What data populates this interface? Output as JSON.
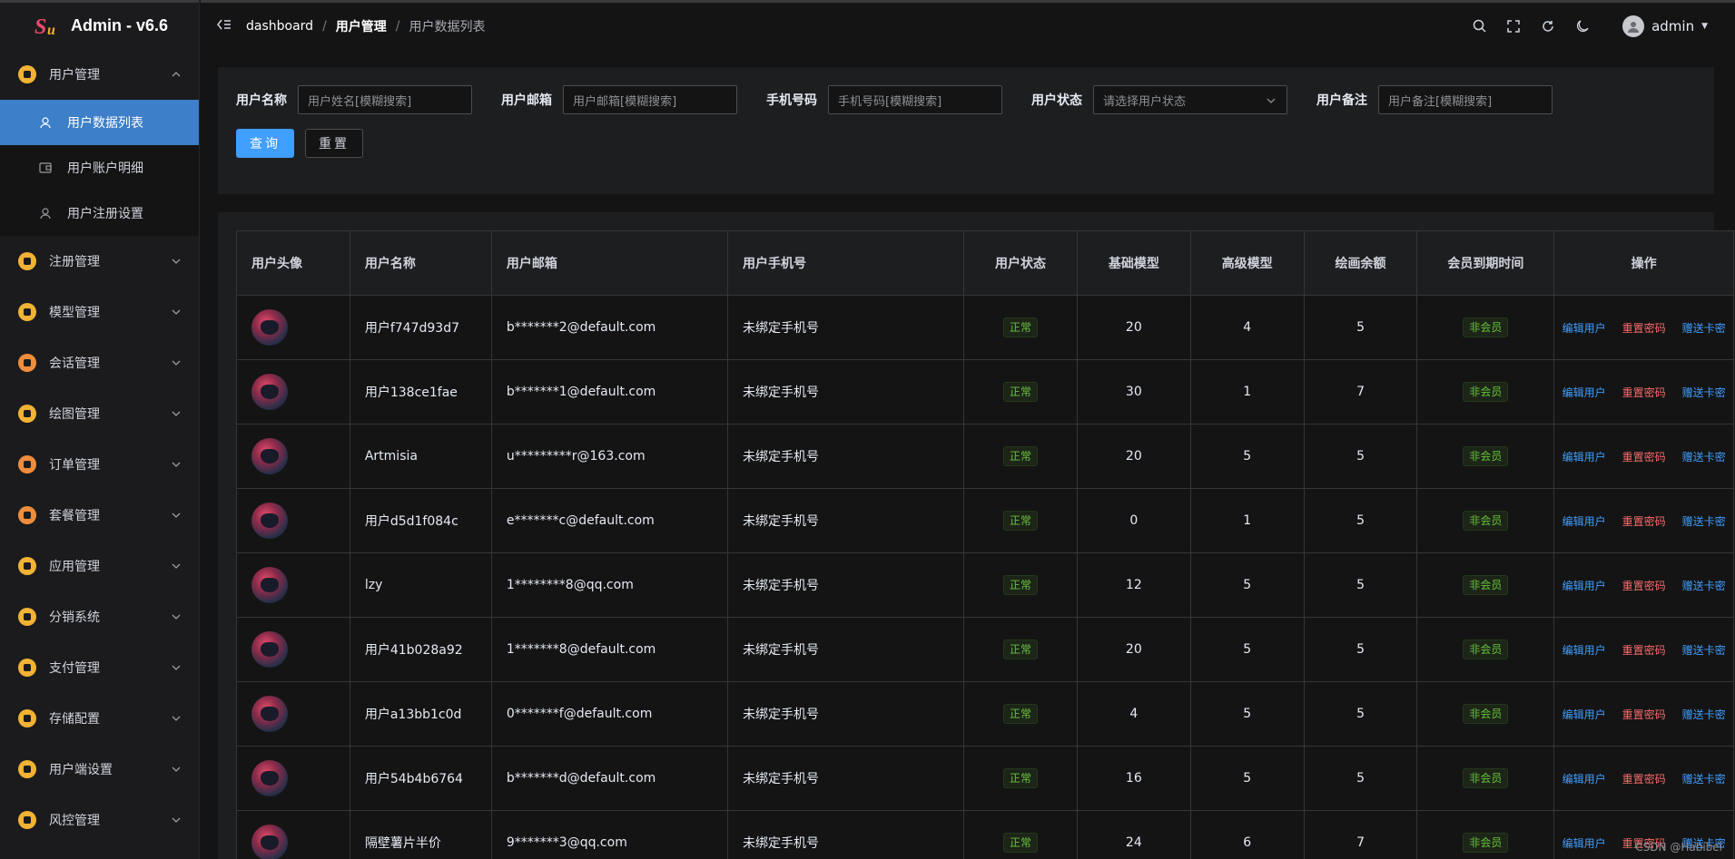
{
  "app": {
    "title": "Admin - v6.6"
  },
  "sidebar": {
    "groups": [
      {
        "label": "用户管理",
        "icon": "user-card-icon",
        "color": "#f2b233",
        "expanded": true,
        "children": [
          {
            "label": "用户数据列表",
            "icon": "user-outline-icon",
            "active": true
          },
          {
            "label": "用户账户明细",
            "icon": "wallet-icon",
            "active": false
          },
          {
            "label": "用户注册设置",
            "icon": "user-outline-icon",
            "active": false
          }
        ]
      },
      {
        "label": "注册管理",
        "icon": "register-icon",
        "color": "#f2b233"
      },
      {
        "label": "模型管理",
        "icon": "model-icon",
        "color": "#f2b233"
      },
      {
        "label": "会话管理",
        "icon": "chat-icon",
        "color": "#f08d3c"
      },
      {
        "label": "绘图管理",
        "icon": "palette-icon",
        "color": "#f2b233"
      },
      {
        "label": "订单管理",
        "icon": "clipboard-icon",
        "color": "#f08d3c"
      },
      {
        "label": "套餐管理",
        "icon": "package-icon",
        "color": "#f08d3c"
      },
      {
        "label": "应用管理",
        "icon": "apps-icon",
        "color": "#f2b233"
      },
      {
        "label": "分销系统",
        "icon": "distribution-icon",
        "color": "#f2b233"
      },
      {
        "label": "支付管理",
        "icon": "payment-icon",
        "color": "#f2b233"
      },
      {
        "label": "存储配置",
        "icon": "storage-icon",
        "color": "#f2b233"
      },
      {
        "label": "用户端设置",
        "icon": "client-settings-icon",
        "color": "#f2b233"
      },
      {
        "label": "风控管理",
        "icon": "shield-icon",
        "color": "#f2b233"
      }
    ]
  },
  "header": {
    "breadcrumb": [
      "dashboard",
      "用户管理",
      "用户数据列表"
    ],
    "user": "admin"
  },
  "search": {
    "name_label": "用户名称",
    "name_placeholder": "用户姓名[模糊搜索]",
    "email_label": "用户邮箱",
    "email_placeholder": "用户邮箱[模糊搜索]",
    "phone_label": "手机号码",
    "phone_placeholder": "手机号码[模糊搜索]",
    "status_label": "用户状态",
    "status_placeholder": "请选择用户状态",
    "remark_label": "用户备注",
    "remark_placeholder": "用户备注[模糊搜索]",
    "query_btn": "查询",
    "reset_btn": "重置"
  },
  "table": {
    "columns": [
      "用户头像",
      "用户名称",
      "用户邮箱",
      "用户手机号",
      "用户状态",
      "基础模型",
      "高级模型",
      "绘画余额",
      "会员到期时间",
      "操作"
    ],
    "rows": [
      {
        "name": "用户f747d93d7",
        "email": "b*******2@default.com",
        "phone": "未绑定手机号",
        "status": "正常",
        "basic": "20",
        "advanced": "4",
        "draw": "5",
        "member": "非会员"
      },
      {
        "name": "用户138ce1fae",
        "email": "b*******1@default.com",
        "phone": "未绑定手机号",
        "status": "正常",
        "basic": "30",
        "advanced": "1",
        "draw": "7",
        "member": "非会员"
      },
      {
        "name": "Artmisia",
        "email": "u*********r@163.com",
        "phone": "未绑定手机号",
        "status": "正常",
        "basic": "20",
        "advanced": "5",
        "draw": "5",
        "member": "非会员"
      },
      {
        "name": "用户d5d1f084c",
        "email": "e*******c@default.com",
        "phone": "未绑定手机号",
        "status": "正常",
        "basic": "0",
        "advanced": "1",
        "draw": "5",
        "member": "非会员"
      },
      {
        "name": "lzy",
        "email": "1********8@qq.com",
        "phone": "未绑定手机号",
        "status": "正常",
        "basic": "12",
        "advanced": "5",
        "draw": "5",
        "member": "非会员"
      },
      {
        "name": "用户41b028a92",
        "email": "1*******8@default.com",
        "phone": "未绑定手机号",
        "status": "正常",
        "basic": "20",
        "advanced": "5",
        "draw": "5",
        "member": "非会员"
      },
      {
        "name": "用户a13bb1c0d",
        "email": "0*******f@default.com",
        "phone": "未绑定手机号",
        "status": "正常",
        "basic": "4",
        "advanced": "5",
        "draw": "5",
        "member": "非会员"
      },
      {
        "name": "用户54b4b6764",
        "email": "b*******d@default.com",
        "phone": "未绑定手机号",
        "status": "正常",
        "basic": "16",
        "advanced": "5",
        "draw": "5",
        "member": "非会员"
      },
      {
        "name": "隔壁薯片半价",
        "email": "9*******3@qq.com",
        "phone": "未绑定手机号",
        "status": "正常",
        "basic": "24",
        "advanced": "6",
        "draw": "7",
        "member": "非会员"
      }
    ],
    "ops": {
      "edit": "编辑用户",
      "reset": "重置密码",
      "gift": "赠送卡密"
    }
  },
  "watermark": "CSDN @Habibei",
  "colors": {
    "primary": "#409eff",
    "danger": "#f56c6c",
    "success": "#67c23a",
    "active_menu": "#3d7fc8"
  }
}
